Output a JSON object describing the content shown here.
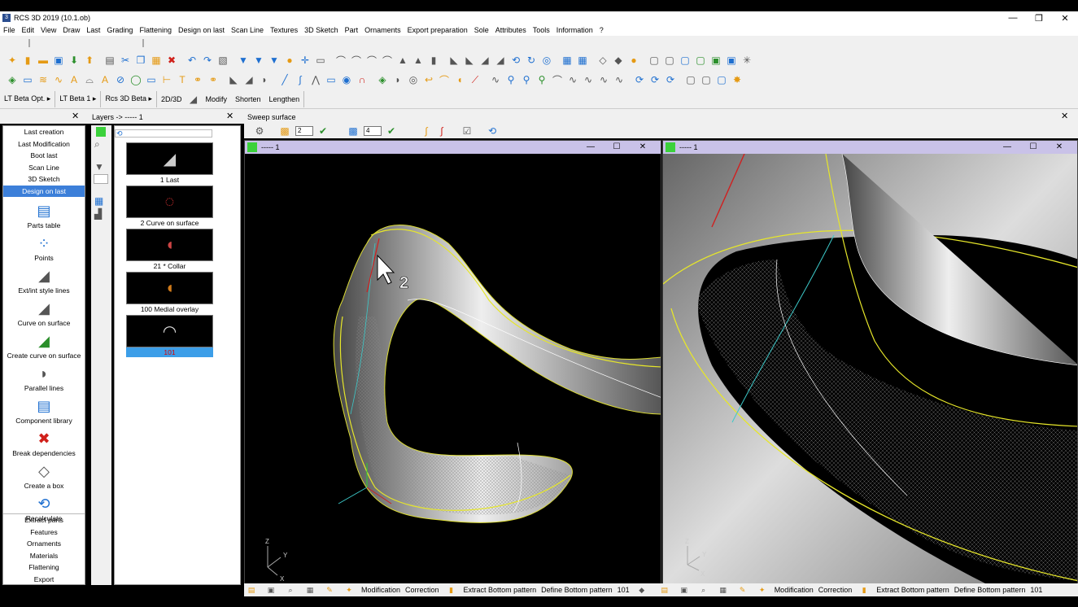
{
  "window": {
    "title": "RCS 3D 2019 (10.1.ob)",
    "min": "—",
    "max": "❐",
    "close": "✕"
  },
  "menu": [
    "File",
    "Edit",
    "View",
    "Draw",
    "Last",
    "Grading",
    "Flattening",
    "Design on last",
    "Scan Line",
    "Textures",
    "3D Sketch",
    "Part",
    "Ornaments",
    "Export preparation",
    "Sole",
    "Attributes",
    "Tools",
    "Information",
    "?"
  ],
  "breadcrumbs": {
    "item1": "LT Beta Opt. ▸",
    "item2": "LT Beta 1 ▸",
    "item3": "Rcs 3D Beta ▸",
    "item4": "2D/3D",
    "modify": "Modify",
    "shorten": "Shorten",
    "lengthen": "Lengthen"
  },
  "panels": {
    "close_left": "✕",
    "layers_title": "Layers -> ----- 1",
    "close_layers": "✕",
    "sweep_title": "Sweep surface",
    "close_sweep": "✕",
    "sweep_val1": "2",
    "sweep_val2": "4"
  },
  "nav": {
    "items": [
      "Last creation",
      "Last Modification",
      "Boot last",
      "Scan Line",
      "3D Sketch",
      "Design on last"
    ],
    "active": "Design on last",
    "tools": [
      "Parts table",
      "Points",
      "Ext/int style lines",
      "Curve on surface",
      "Create curve on surface",
      "Parallel lines",
      "Component library",
      "Break dependencies",
      "Create a box",
      "Recalculate"
    ],
    "bottom": [
      "Extract parts",
      "Features",
      "Ornaments",
      "Materials",
      "Flattening",
      "Export"
    ]
  },
  "layers": [
    {
      "label": "1   Last"
    },
    {
      "label": "2   Curve on surface"
    },
    {
      "label": "21   * Collar"
    },
    {
      "label": "100   Medial overlay"
    },
    {
      "label": "101"
    }
  ],
  "viewports": [
    {
      "title": "----- 1"
    },
    {
      "title": "----- 1"
    }
  ],
  "status": {
    "modification": "Modification",
    "correction": "Correction",
    "extract": "Extract Bottom pattern",
    "define": "Define Bottom pattern",
    "layer": "101"
  },
  "cursor_label": "2",
  "axes": {
    "z": "Z",
    "y": "Y",
    "x": "X"
  },
  "colors": {
    "accent": "#3c7fd9",
    "viewport_header": "#c9c2e8",
    "curve_yellow": "#e6e62a",
    "curve_cyan": "#3cc8c8",
    "curve_red": "#d02020"
  }
}
